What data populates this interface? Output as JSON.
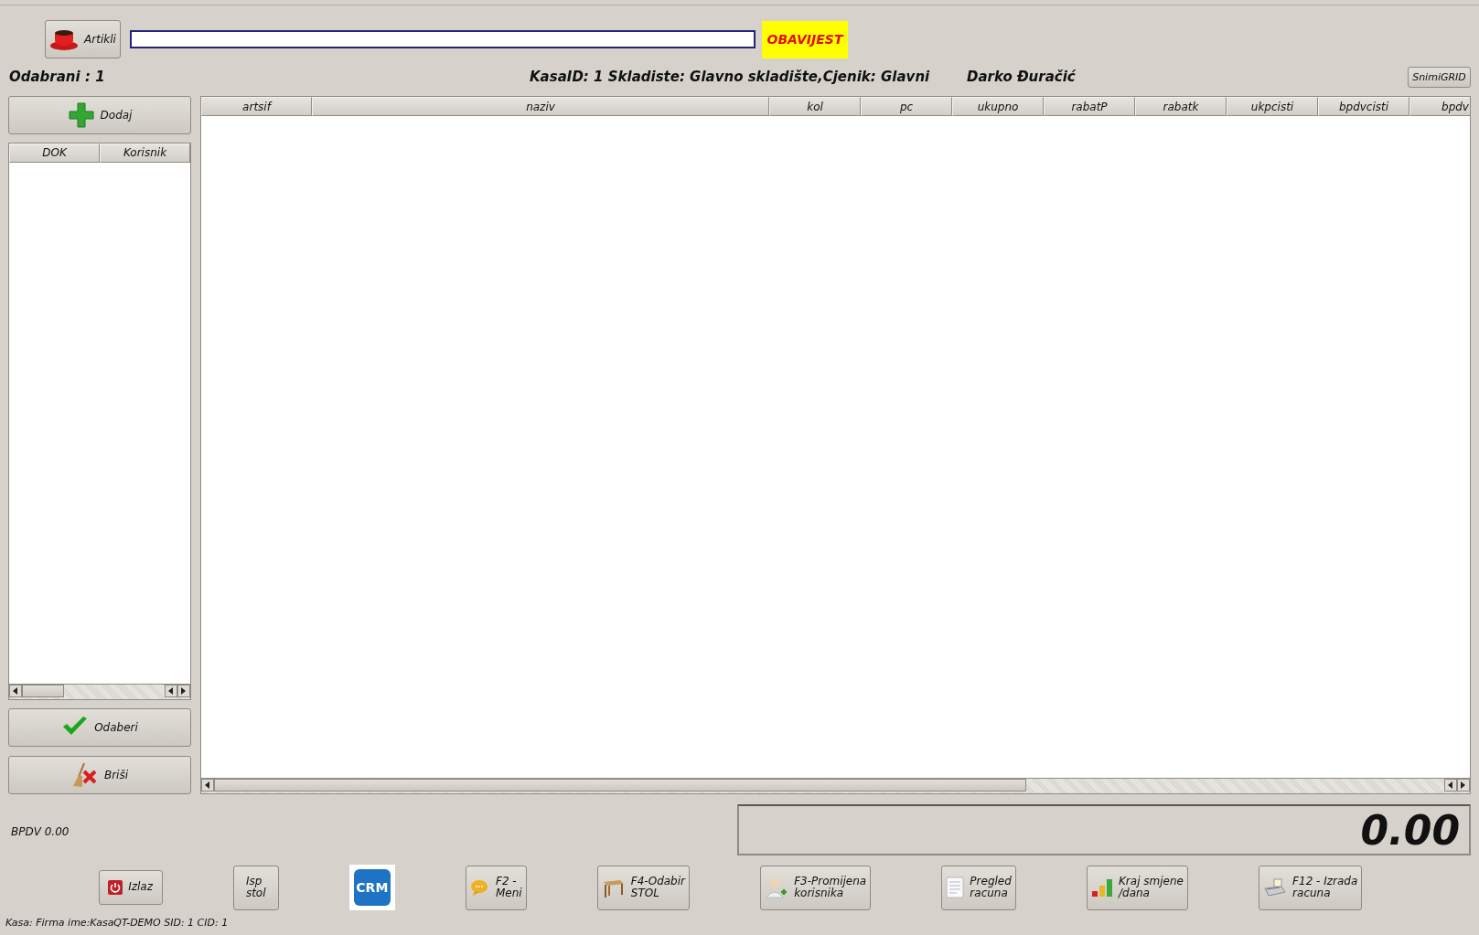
{
  "toolbar": {
    "articles_button": "Artikli",
    "notice": "OBAVIJEST"
  },
  "info": {
    "selected_count_label": "Odabrani  :  1",
    "register_info": "KasaID: 1 Skladiste: Glavno skladište,Cjenik: Glavni",
    "user": "Darko Đuračić",
    "save_grid_button": "SnimiGRID"
  },
  "left_panel": {
    "add_button": "Dodaj",
    "columns": [
      "DOK",
      "Korisnik"
    ],
    "select_button": "Odaberi",
    "delete_button": "Briši"
  },
  "table": {
    "columns": [
      "artsif",
      "naziv",
      "kol",
      "pc",
      "ukupno",
      "rabatP",
      "rabatk",
      "ukpcisti",
      "bpdvcisti",
      "bpdv"
    ]
  },
  "bpdv": "BPDV  0.00",
  "total": "0.00",
  "buttons": [
    {
      "kind": "power",
      "label": "Izlaz"
    },
    {
      "kind": "plain",
      "label": "Isp\nstol"
    },
    {
      "kind": "crm",
      "label": "CRM"
    },
    {
      "kind": "chat",
      "label": "F2 -\nMeni"
    },
    {
      "kind": "table",
      "label": "F4-Odabir\nSTOL"
    },
    {
      "kind": "user",
      "label": "F3-Promijena\nkorisnika"
    },
    {
      "kind": "document",
      "label": "Pregled\nracuna"
    },
    {
      "kind": "bars",
      "label": "Kraj smjene\n/dana"
    },
    {
      "kind": "register",
      "label": "F12 - Izrada\nracuna"
    }
  ],
  "status_bar": "Kasa: Firma ime:KasaQT-DEMO SID: 1 CID: 1"
}
